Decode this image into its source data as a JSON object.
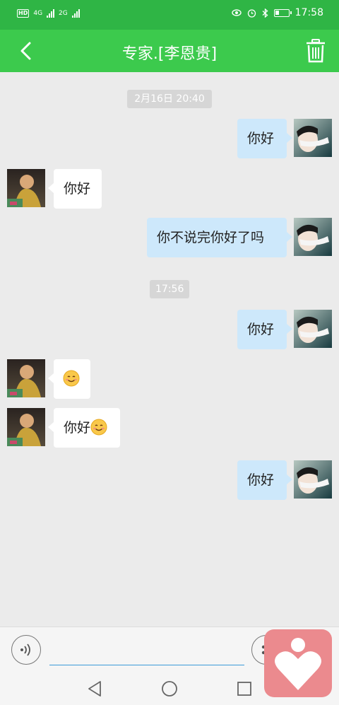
{
  "status_bar": {
    "hd": "HD",
    "net1": "4G",
    "net2": "2G",
    "time": "17:58",
    "battery_level": 0.3
  },
  "header": {
    "title": "专家.[李恩贵]",
    "back_icon": "back-arrow-icon",
    "delete_icon": "trash-icon"
  },
  "colors": {
    "status_bar": "#2fb545",
    "title_bar": "#3cca4d",
    "bubble_right": "#cde8fb",
    "bubble_left": "#ffffff",
    "chat_bg": "#ebebeb",
    "float_button": "#eb8a8e"
  },
  "messages": {
    "time1": "2月16日 20:40",
    "m1": "你好",
    "m2": "你好",
    "m3": "你不说完你好了吗",
    "time2": "17:56",
    "m4": "你好",
    "m5_emoji": "smile-emoji",
    "m6": "你好",
    "m6_emoji": "smile-emoji",
    "m7": "你好"
  },
  "input": {
    "placeholder": "",
    "voice_icon": "voice-icon",
    "emoji_icon": "emoji-icon"
  },
  "nav": {
    "back": "nav-back-icon",
    "home": "nav-home-icon",
    "recent": "nav-recent-icon"
  },
  "float_button": {
    "icon": "heart-person-icon"
  }
}
